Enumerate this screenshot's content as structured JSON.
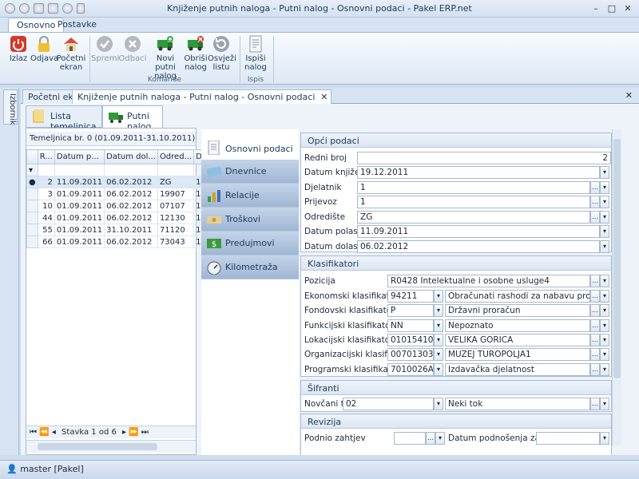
{
  "window": {
    "title": "Knjiženje putnih naloga - Putni nalog - Osnovni podaci - Pakel ERP.net"
  },
  "ribbon_tabs": [
    "Osnovno",
    "Postavke"
  ],
  "ribbon": {
    "buttons": [
      {
        "label": "Izlaz",
        "enabled": true
      },
      {
        "label": "Odjava",
        "enabled": true
      },
      {
        "label": "Početni ekran",
        "enabled": true
      },
      {
        "label": "Spremi",
        "enabled": false
      },
      {
        "label": "Odbaci",
        "enabled": false
      },
      {
        "label": "Novi putni nalog",
        "enabled": true
      },
      {
        "label": "Obriši nalog",
        "enabled": true
      },
      {
        "label": "Osvježi listu",
        "enabled": true
      },
      {
        "label": "Ispiši nalog",
        "enabled": true
      }
    ],
    "groups": {
      "komande": "Komande",
      "ispis": "Ispis"
    }
  },
  "side_tab": "Izbornik",
  "doc_tabs": [
    "Početni ekran",
    "Knjiženje putnih naloga - Putni nalog - Osnovni podaci"
  ],
  "sub_tabs": [
    "Lista temeljnica",
    "Putni nalog"
  ],
  "grid": {
    "group_text": "Temeljnica br. 0 (01.09.2011-31.10.2011), Status: O",
    "columns": [
      "R...",
      "Datum p...",
      "Datum dol...",
      "Odred...",
      "Djelat"
    ],
    "rows": [
      [
        "2",
        "11.09.2011",
        "06.02.2012",
        "ZG",
        "1"
      ],
      [
        "3",
        "01.09.2011",
        "06.02.2012",
        "19907",
        "1"
      ],
      [
        "10",
        "01.09.2011",
        "06.02.2012",
        "07107",
        "1"
      ],
      [
        "44",
        "01.09.2011",
        "06.02.2012",
        "12130",
        "1"
      ],
      [
        "55",
        "01.09.2011",
        "31.10.2011",
        "71120",
        "1"
      ],
      [
        "66",
        "01.09.2011",
        "06.02.2012",
        "73043",
        "1"
      ]
    ],
    "footer": "Stavka 1 od 6"
  },
  "nav": [
    "Osnovni podaci",
    "Dnevnice",
    "Relacije",
    "Troškovi",
    "Predujmovi",
    "Kilometraža"
  ],
  "opci": {
    "title": "Opći podaci",
    "rows": [
      {
        "label": "Redni broj",
        "value": "2"
      },
      {
        "label": "Datum knjiženja",
        "value": "19.12.2011"
      },
      {
        "label": "Djelatnik",
        "value": "1"
      },
      {
        "label": "Prijevoz",
        "value": "1"
      },
      {
        "label": "Odredište",
        "value": "ZG"
      },
      {
        "label": "Datum polaska",
        "value": "11.09.2011"
      },
      {
        "label": "Datum dolaska",
        "value": "06.02.2012"
      }
    ]
  },
  "klas": {
    "title": "Klasifikatori",
    "pozicija": {
      "label": "Pozicija",
      "value": "R0428 Intelektualne i osobne usluge4"
    },
    "rows": [
      {
        "label": "Ekonomski klasifikator",
        "code": "94211",
        "text": "Obračunati rashodi za nabavu proizvedene..."
      },
      {
        "label": "Fondovski klasifikator",
        "code": "P",
        "text": "Državni proračun"
      },
      {
        "label": "Funkcijski klasifikator",
        "code": "NN",
        "text": "Nepoznato"
      },
      {
        "label": "Lokacijski klasifikator",
        "code": "01015410",
        "text": "VELIKA GORICA"
      },
      {
        "label": "Organizacijski klasifikator",
        "code": "00701303",
        "text": "MUZEJ TUROPOLJA1"
      },
      {
        "label": "Programski klasifikator",
        "code": "7010026A0...",
        "text": "Izdavačka djelatnost"
      }
    ]
  },
  "sifranti": {
    "title": "Šifranti",
    "label": "Novčani tok",
    "code": "02",
    "text": "Neki tok"
  },
  "revizija": {
    "title": "Revizija",
    "label": "Podnio zahtjev",
    "label2": "Datum podnošenja zahtjeva"
  },
  "status": {
    "user": "master [Pakel]"
  }
}
